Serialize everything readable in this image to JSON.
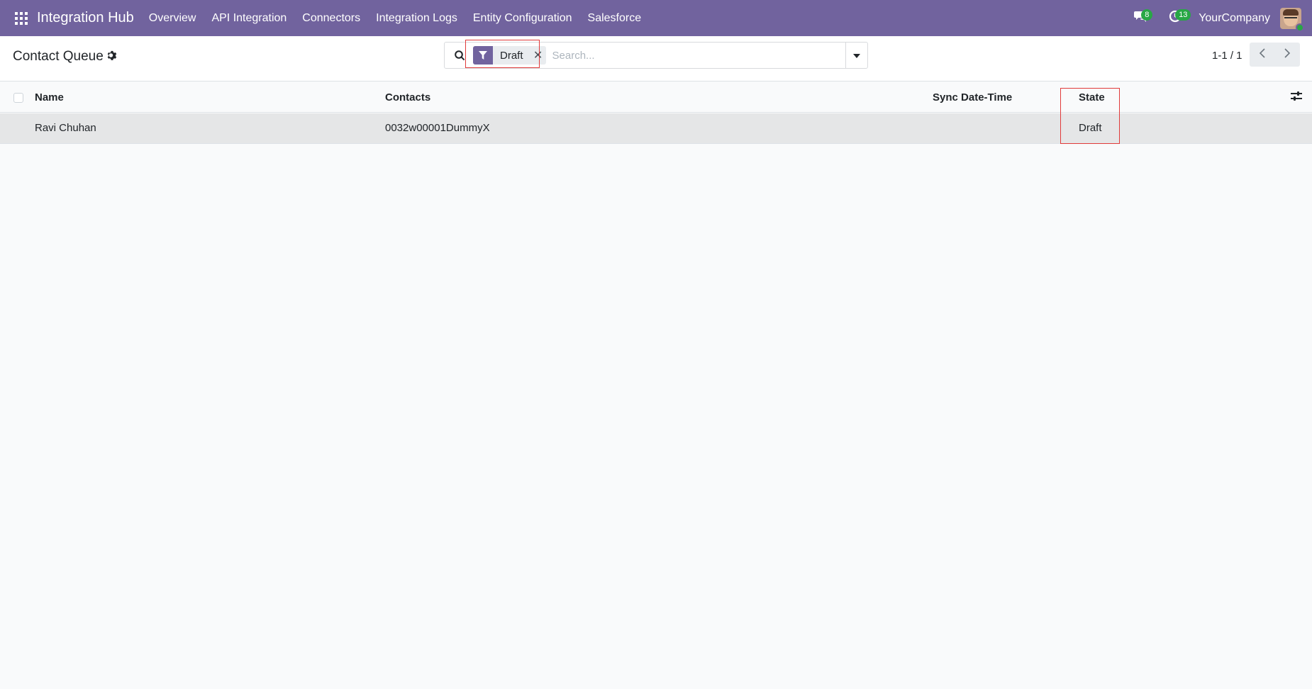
{
  "navbar": {
    "app_title": "Integration Hub",
    "menu": [
      "Overview",
      "API Integration",
      "Connectors",
      "Integration Logs",
      "Entity Configuration",
      "Salesforce"
    ],
    "messages_count": "8",
    "activities_count": "13",
    "company": "YourCompany",
    "icons": {
      "apps": "apps-grid-icon",
      "messages": "chat-bubbles-icon",
      "activities": "clock-icon"
    }
  },
  "control_panel": {
    "breadcrumb": "Contact Queue",
    "search": {
      "facet_label": "Draft",
      "facet_remove": "✕",
      "placeholder": "Search...",
      "value": ""
    },
    "pager": "1-1 / 1"
  },
  "table": {
    "columns": [
      "Name",
      "Contacts",
      "Sync Date-Time",
      "State"
    ],
    "rows": [
      {
        "name": "Ravi Chuhan",
        "contacts": "0032w00001DummyX",
        "sync_date_time": "",
        "state": "Draft"
      }
    ]
  },
  "colors": {
    "brand": "#71639e",
    "badge": "#28a745",
    "highlight": "#e03a3a",
    "row_selected": "#e5e6e7"
  }
}
